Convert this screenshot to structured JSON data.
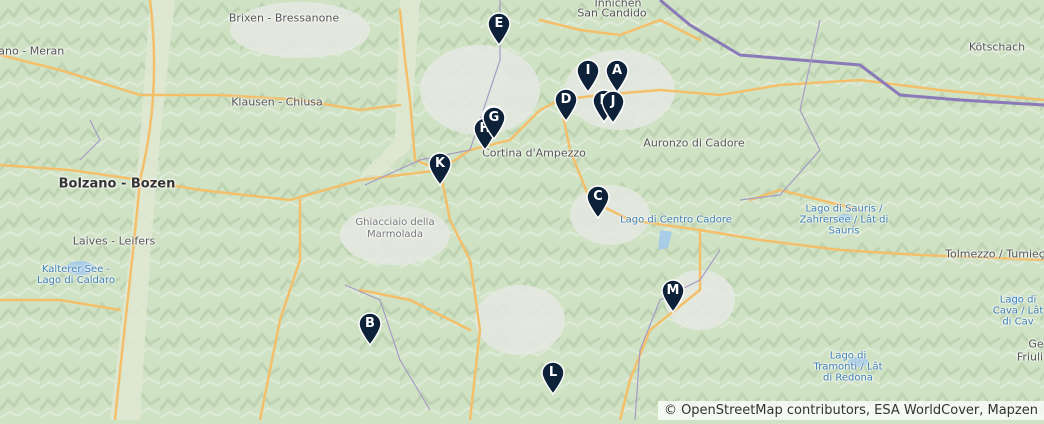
{
  "map": {
    "places": [
      {
        "id": "innichen",
        "text": "Innichen"
      },
      {
        "id": "sancandido",
        "text": "San Candido"
      },
      {
        "id": "brixen",
        "text": "Brixen - Bressanone"
      },
      {
        "id": "meran",
        "text": "rano - Meran"
      },
      {
        "id": "klausen",
        "text": "Klausen - Chiusa"
      },
      {
        "id": "bolzano",
        "text": "Bolzano - Bozen"
      },
      {
        "id": "laives",
        "text": "Laives - Leifers"
      },
      {
        "id": "kalterer",
        "text": "Kalterer See - Lago di Caldaro"
      },
      {
        "id": "cortina",
        "text": "Cortina d'Ampezzo"
      },
      {
        "id": "auronzo",
        "text": "Auronzo di Cadore"
      },
      {
        "id": "kotschach",
        "text": "Kötschach"
      },
      {
        "id": "marmolada",
        "text": "Ghiacciaio della Marmolada"
      },
      {
        "id": "centrocadore",
        "text": "Lago di Centro Cadore"
      },
      {
        "id": "sauris",
        "text": "Lago di Sauris / Zahrersee / Lât di Sauris"
      },
      {
        "id": "tolmezzo",
        "text": "Tolmezzo / Tumieç"
      },
      {
        "id": "cava",
        "text": "Lago di Cava / Lât di Cav"
      },
      {
        "id": "tramonti",
        "text": "Lago di Tramonti / Lât di Redona"
      },
      {
        "id": "friuli",
        "text": "Friuli"
      },
      {
        "id": "ge",
        "text": "Ge"
      }
    ],
    "markers": [
      "A",
      "B",
      "C",
      "D",
      "E",
      "F",
      "G",
      "H",
      "I",
      "J",
      "K",
      "L",
      "M"
    ],
    "marker_color": "#0d2138",
    "attribution": "© OpenStreetMap contributors, ESA WorldCover, Mapzen"
  }
}
